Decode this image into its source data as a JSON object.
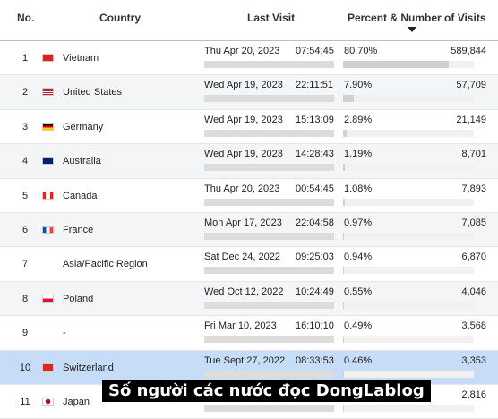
{
  "header": {
    "no": "No.",
    "country": "Country",
    "last_visit": "Last Visit",
    "percent": "Percent & Number of Visits"
  },
  "rows": [
    {
      "no": "1",
      "country": "Vietnam",
      "date": "Thu Apr 20, 2023",
      "time": "07:54:45",
      "percent": "80.70%",
      "count": "589,844",
      "share": 0.807,
      "flag": "vietnam-flag-icon"
    },
    {
      "no": "2",
      "country": "United States",
      "date": "Wed Apr 19, 2023",
      "time": "22:11:51",
      "percent": "7.90%",
      "count": "57,709",
      "share": 0.079,
      "flag": "united-states-flag-icon"
    },
    {
      "no": "3",
      "country": "Germany",
      "date": "Wed Apr 19, 2023",
      "time": "15:13:09",
      "percent": "2.89%",
      "count": "21,149",
      "share": 0.0289,
      "flag": "germany-flag-icon"
    },
    {
      "no": "4",
      "country": "Australia",
      "date": "Wed Apr 19, 2023",
      "time": "14:28:43",
      "percent": "1.19%",
      "count": "8,701",
      "share": 0.0119,
      "flag": "australia-flag-icon"
    },
    {
      "no": "5",
      "country": "Canada",
      "date": "Thu Apr 20, 2023",
      "time": "00:54:45",
      "percent": "1.08%",
      "count": "7,893",
      "share": 0.0108,
      "flag": "canada-flag-icon"
    },
    {
      "no": "6",
      "country": "France",
      "date": "Mon Apr 17, 2023",
      "time": "22:04:58",
      "percent": "0.97%",
      "count": "7,085",
      "share": 0.0097,
      "flag": "france-flag-icon"
    },
    {
      "no": "7",
      "country": "Asia/Pacific Region",
      "date": "Sat Dec 24, 2022",
      "time": "09:25:03",
      "percent": "0.94%",
      "count": "6,870",
      "share": 0.0094,
      "flag": ""
    },
    {
      "no": "8",
      "country": "Poland",
      "date": "Wed Oct 12, 2022",
      "time": "10:24:49",
      "percent": "0.55%",
      "count": "4,046",
      "share": 0.0055,
      "flag": "poland-flag-icon"
    },
    {
      "no": "9",
      "country": "-",
      "date": "Fri Mar 10, 2023",
      "time": "16:10:10",
      "percent": "0.49%",
      "count": "3,568",
      "share": 0.0049,
      "flag": ""
    },
    {
      "no": "10",
      "country": "Switzerland",
      "date": "Tue Sept 27, 2022",
      "time": "08:33:53",
      "percent": "0.46%",
      "count": "3,353",
      "share": 0.0046,
      "flag": "switzerland-flag-icon",
      "selected": true
    },
    {
      "no": "11",
      "country": "Japan",
      "date": "",
      "time": "",
      "percent": "",
      "count": "2,816",
      "share": 0.0039,
      "flag": "japan-flag-icon"
    }
  ],
  "overlay_caption": "Số người các nước đọc DongLablog"
}
